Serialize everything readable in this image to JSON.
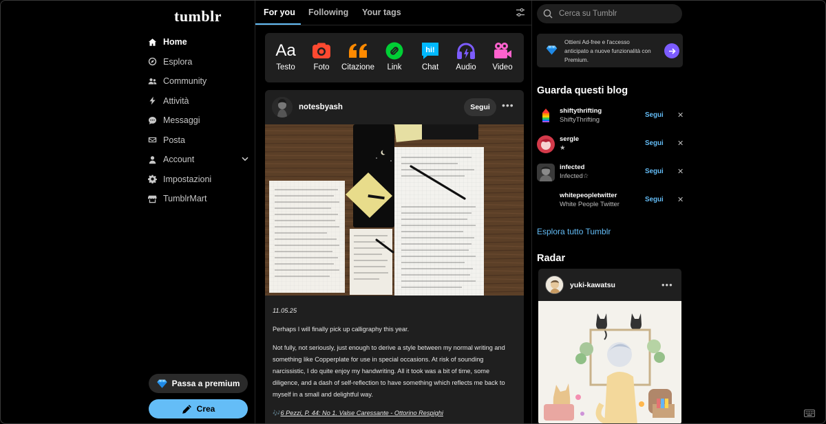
{
  "app": {
    "logo": "tumblr"
  },
  "sidebar": {
    "items": [
      {
        "label": "Home",
        "icon": "home-icon",
        "active": true
      },
      {
        "label": "Esplora",
        "icon": "compass-icon"
      },
      {
        "label": "Community",
        "icon": "community-icon"
      },
      {
        "label": "Attività",
        "icon": "lightning-icon"
      },
      {
        "label": "Messaggi",
        "icon": "message-icon"
      },
      {
        "label": "Posta",
        "icon": "mail-icon"
      },
      {
        "label": "Account",
        "icon": "user-icon",
        "expandable": true
      },
      {
        "label": "Impostazioni",
        "icon": "gear-icon"
      },
      {
        "label": "TumblrMart",
        "icon": "store-icon"
      }
    ],
    "premium_label": "Passa a premium",
    "create_label": "Crea"
  },
  "feed": {
    "tabs": [
      {
        "label": "For you",
        "active": true
      },
      {
        "label": "Following"
      },
      {
        "label": "Your tags"
      }
    ],
    "post_types": [
      {
        "label": "Testo",
        "icon": "text-icon",
        "color": "#ffffff"
      },
      {
        "label": "Foto",
        "icon": "camera-icon",
        "color": "#ff4930"
      },
      {
        "label": "Citazione",
        "icon": "quote-icon",
        "color": "#ff8a00"
      },
      {
        "label": "Link",
        "icon": "link-icon",
        "color": "#00cf35"
      },
      {
        "label": "Chat",
        "icon": "chat-icon",
        "color": "#00b8ff"
      },
      {
        "label": "Audio",
        "icon": "headphones-icon",
        "color": "#7c5cff"
      },
      {
        "label": "Video",
        "icon": "video-icon",
        "color": "#ff62ce"
      }
    ],
    "post": {
      "blog": "notesbyash",
      "follow_label": "Segui",
      "date": "11.05.25",
      "paragraphs": [
        "Perhaps I will finally pick up calligraphy this year.",
        "Not fully, not seriously, just enough to derive a style between my normal writing and something like Copperplate for use in special occasions. At risk of sounding narcissistic, I do quite enjoy my handwriting. All it took was a bit of time, some diligence, and a dash of self-reflection to have something which reflects me back to myself in a small and delightful way."
      ],
      "music_link": "6 Pezzi, P. 44: No 1. Valse Caressante - Ottorino Respighi"
    }
  },
  "right": {
    "search_placeholder": "Cerca su Tumblr",
    "promo_text": "Ottieni Ad-free e l'accesso anticipato a nuove funzionalità con Premium.",
    "recommend_title": "Guarda questi blog",
    "recommendations": [
      {
        "name": "shiftythrifting",
        "sub": "ShiftyThrifting",
        "follow": "Segui"
      },
      {
        "name": "sergle",
        "sub": "★",
        "follow": "Segui"
      },
      {
        "name": "infected",
        "sub": "Infected☆",
        "follow": "Segui"
      },
      {
        "name": "whitepeopletwitter",
        "sub": "White People Twitter",
        "follow": "Segui"
      }
    ],
    "explore_label": "Esplora tutto Tumblr",
    "radar_title": "Radar",
    "radar_blog": "yuki-kawatsu"
  },
  "colors": {
    "accent": "#64bdf7",
    "premium_purple": "#7c5cff",
    "panel": "#1f1f1f"
  }
}
